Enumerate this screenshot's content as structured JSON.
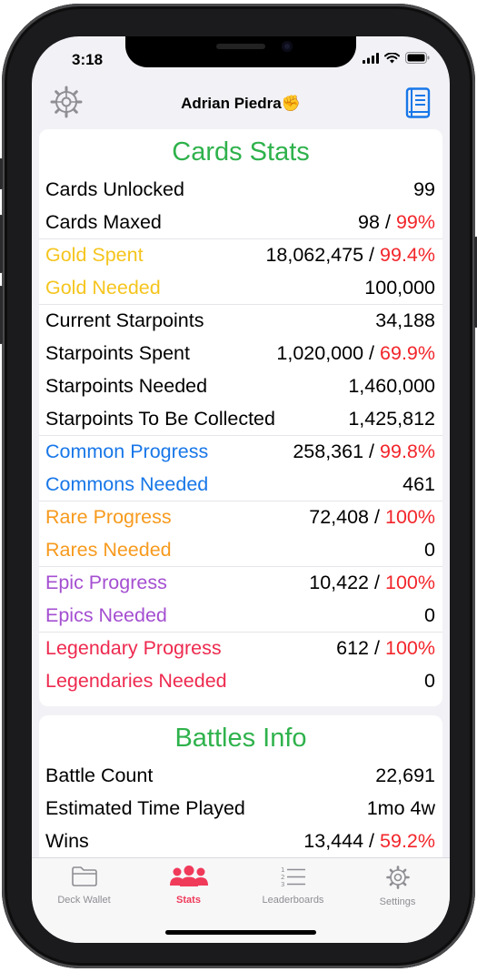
{
  "status": {
    "time": "3:18"
  },
  "nav": {
    "title": "Adrian Piedra✊"
  },
  "colors": {
    "green": "#2fb24c",
    "gold": "#f5c51e",
    "blue": "#1877e8",
    "orange": "#f79a1d",
    "purple": "#a44fd1",
    "red": "#ee2a4f",
    "pct_red": "#f2262b",
    "tab_active": "#f03a5a"
  },
  "cards_stats": {
    "title": "Cards Stats",
    "rows": [
      {
        "label": "Cards Unlocked",
        "value": "99",
        "pct": ""
      },
      {
        "label": "Cards Maxed",
        "value": "98",
        "pct": "99%"
      },
      {
        "label": "Gold Spent",
        "value": "18,062,475",
        "pct": "99.4%"
      },
      {
        "label": "Gold Needed",
        "value": "100,000",
        "pct": ""
      },
      {
        "label": "Current Starpoints",
        "value": "34,188",
        "pct": ""
      },
      {
        "label": "Starpoints Spent",
        "value": "1,020,000",
        "pct": "69.9%"
      },
      {
        "label": "Starpoints Needed",
        "value": "1,460,000",
        "pct": ""
      },
      {
        "label": "Starpoints To Be Collected",
        "value": "1,425,812",
        "pct": ""
      },
      {
        "label": "Common Progress",
        "value": "258,361",
        "pct": "99.8%"
      },
      {
        "label": "Commons Needed",
        "value": "461",
        "pct": ""
      },
      {
        "label": "Rare Progress",
        "value": "72,408",
        "pct": "100%"
      },
      {
        "label": "Rares Needed",
        "value": "0",
        "pct": ""
      },
      {
        "label": "Epic Progress",
        "value": "10,422",
        "pct": "100%"
      },
      {
        "label": "Epics Needed",
        "value": "0",
        "pct": ""
      },
      {
        "label": "Legendary Progress",
        "value": "612",
        "pct": "100%"
      },
      {
        "label": "Legendaries Needed",
        "value": "0",
        "pct": ""
      }
    ]
  },
  "battles_info": {
    "title": "Battles Info",
    "rows": [
      {
        "label": "Battle Count",
        "value": "22,691",
        "pct": ""
      },
      {
        "label": "Estimated Time Played",
        "value": "1mo 4w",
        "pct": ""
      },
      {
        "label": "Wins",
        "value": "13,444",
        "pct": "59.2%"
      }
    ]
  },
  "slash": "/",
  "tabs": [
    {
      "label": "Deck Wallet",
      "icon": "folder-icon"
    },
    {
      "label": "Stats",
      "icon": "people-icon"
    },
    {
      "label": "Leaderboards",
      "icon": "numbered-list-icon"
    },
    {
      "label": "Settings",
      "icon": "gear-icon"
    }
  ]
}
